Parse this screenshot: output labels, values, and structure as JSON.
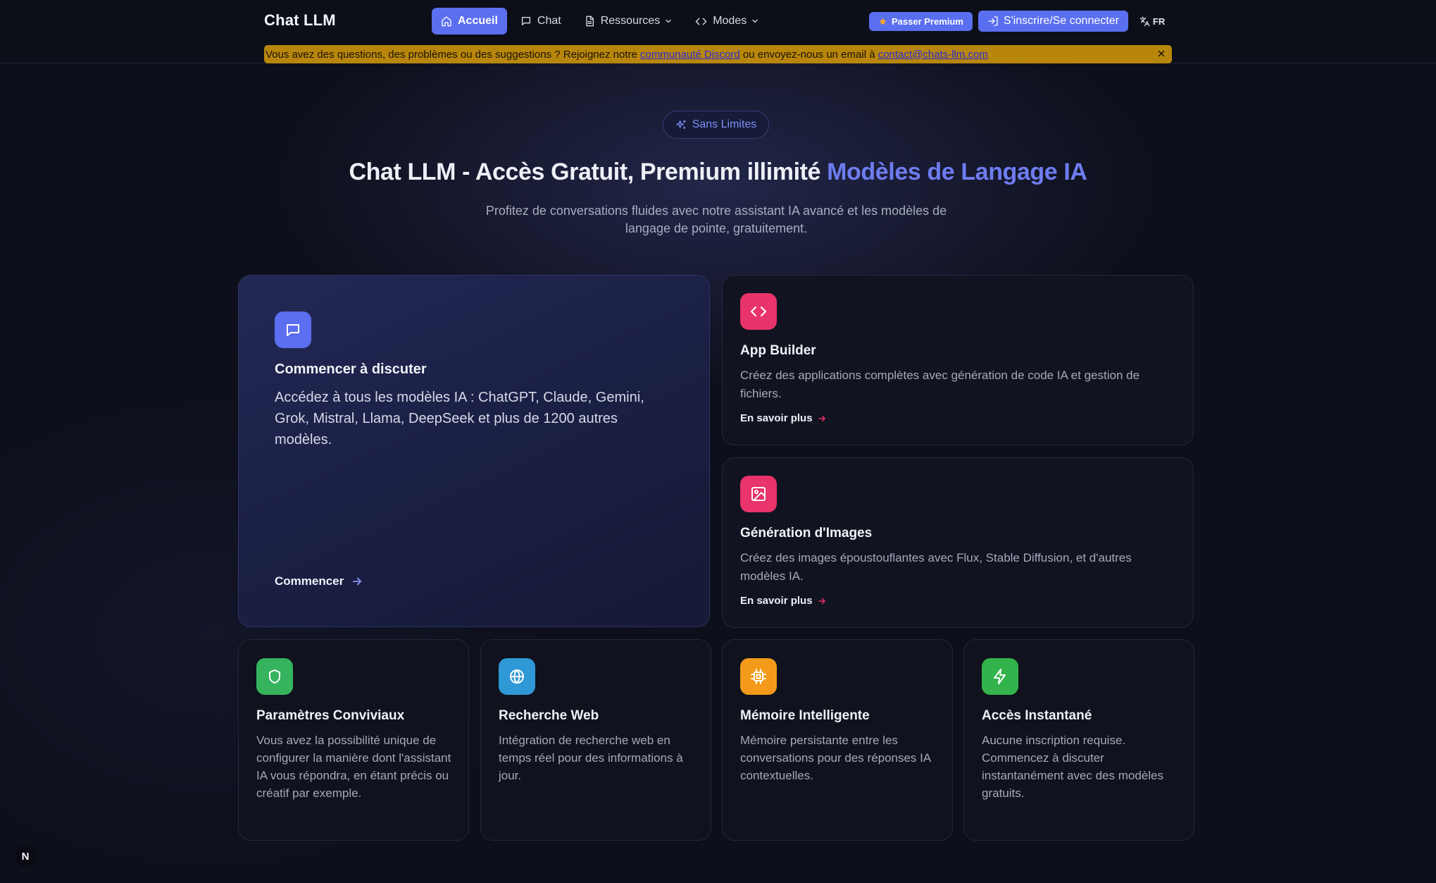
{
  "nav": {
    "brand": "Chat LLM",
    "links": [
      {
        "label": "Accueil",
        "icon": "home-icon",
        "active": true
      },
      {
        "label": "Chat",
        "icon": "chat-icon"
      },
      {
        "label": "Ressources",
        "icon": "document-icon",
        "dropdown": true
      },
      {
        "label": "Modes",
        "icon": "code-icon",
        "dropdown": true
      }
    ],
    "premium_label": "Passer Premium",
    "login_label": "S'inscrire/Se connecter",
    "language": "FR"
  },
  "banner": {
    "text_before": "Vous avez des questions, des problèmes ou des suggestions ? Rejoignez notre ",
    "discord_link": "communauté Discord",
    "text_middle": " ou envoyez-nous un email à ",
    "email_link": "contact@chats-llm.com"
  },
  "hero": {
    "badge": "Sans Limites",
    "title_main": "Chat LLM - Accès Gratuit, Premium illimité ",
    "title_accent": "Modèles de Langage IA",
    "subtitle": "Profitez de conversations fluides avec notre assistant IA avancé et les modèles de langage de pointe, gratuitement."
  },
  "cards": {
    "main": {
      "title": "Commencer à discuter",
      "description": "Accédez à tous les modèles IA : ChatGPT, Claude, Gemini, Grok, Mistral, Llama, DeepSeek et plus de 1200 autres modèles.",
      "cta": "Commencer",
      "icon": "chat-bubble-icon",
      "color": "#5b6ff0"
    },
    "app_builder": {
      "title": "App Builder",
      "description": "Créez des applications complètes avec génération de code IA et gestion de fichiers.",
      "cta": "En savoir plus",
      "icon": "code-icon",
      "color": "#e8336b"
    },
    "images": {
      "title": "Génération d'Images",
      "description": "Créez des images époustouflantes avec Flux, Stable Diffusion, et d'autres modèles IA.",
      "cta": "En savoir plus",
      "icon": "image-icon",
      "color": "#e8336b"
    },
    "features": [
      {
        "title": "Paramètres Conviviaux",
        "description": "Vous avez la possibilité unique de configurer la manière dont l'assistant IA vous répondra, en étant précis ou créatif par exemple.",
        "icon": "shield-icon",
        "color": "#35b35d"
      },
      {
        "title": "Recherche Web",
        "description": "Intégration de recherche web en temps réel pour des informations à jour.",
        "icon": "globe-icon",
        "color": "#2f98d6"
      },
      {
        "title": "Mémoire Intelligente",
        "description": "Mémoire persistante entre les conversations pour des réponses IA contextuelles.",
        "icon": "chip-icon",
        "color": "#f39a1a"
      },
      {
        "title": "Accès Instantané",
        "description": "Aucune inscription requise. Commencez à discuter instantanément avec des modèles gratuits.",
        "icon": "lightning-icon",
        "color": "#33b34c"
      }
    ]
  },
  "bottom_badge": "N"
}
